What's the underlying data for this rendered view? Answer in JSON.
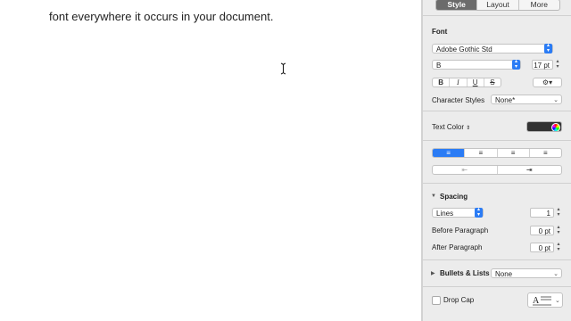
{
  "document": {
    "text": "font everywhere it occurs in your document."
  },
  "inspector": {
    "tabs": [
      {
        "label": "Style",
        "active": true
      },
      {
        "label": "Layout",
        "active": false
      },
      {
        "label": "More",
        "active": false
      }
    ],
    "font_section_label": "Font",
    "font_family": "Adobe Gothic Std",
    "font_style": "B",
    "font_size": "17 pt",
    "format_buttons": {
      "bold": "B",
      "italic": "I",
      "underline": "U",
      "strike": "S",
      "gear": "⚙"
    },
    "character_styles_label": "Character Styles",
    "character_styles_value": "None*",
    "text_color_label": "Text Color",
    "text_color_value": "#333333",
    "alignment_buttons": [
      "≡",
      "≡",
      "≡",
      "≡"
    ],
    "indent_buttons": [
      "⇤",
      "⇥"
    ],
    "spacing_label": "Spacing",
    "line_spacing_mode": "Lines",
    "line_spacing_value": "1",
    "before_paragraph_label": "Before Paragraph",
    "before_paragraph_value": "0 pt",
    "after_paragraph_label": "After Paragraph",
    "after_paragraph_value": "0 pt",
    "bullets_label": "Bullets & Lists",
    "bullets_value": "None",
    "drop_cap_label": "Drop Cap",
    "drop_cap_checked": false,
    "accent_color": "#2b7cf5"
  }
}
